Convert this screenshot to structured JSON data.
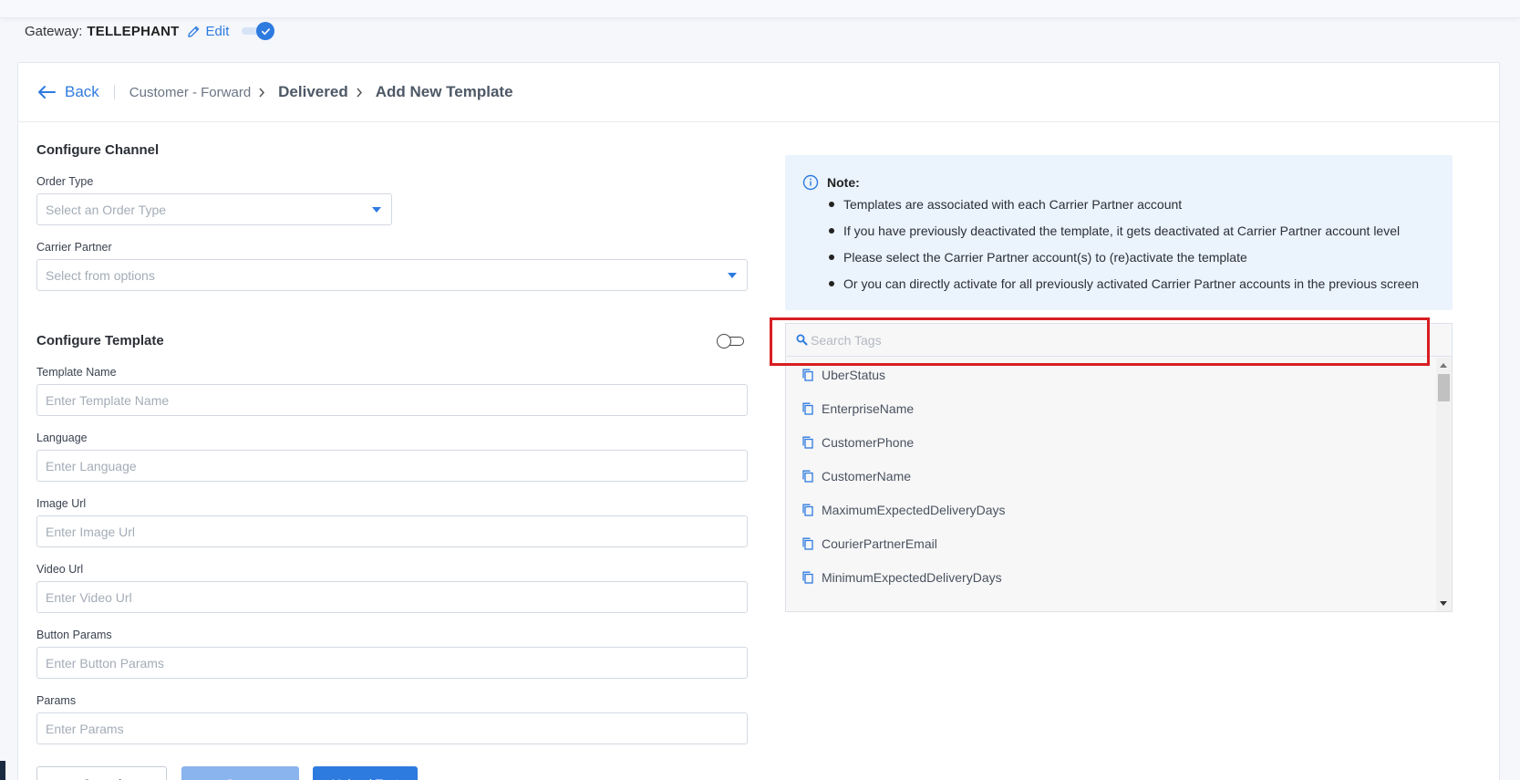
{
  "gateway": {
    "label": "Gateway:",
    "name": "TELLEPHANT",
    "edit_label": "Edit",
    "enabled": true
  },
  "breadcrumb": {
    "back_label": "Back",
    "items": [
      "Customer - Forward",
      "Delivered",
      "Add New Template"
    ]
  },
  "configure_channel": {
    "title": "Configure Channel",
    "order_type": {
      "label": "Order Type",
      "placeholder": "Select an Order Type"
    },
    "carrier_partner": {
      "label": "Carrier Partner",
      "placeholder": "Select from options"
    }
  },
  "configure_template": {
    "title": "Configure Template",
    "toggle_on": false,
    "fields": [
      {
        "label": "Template Name",
        "placeholder": "Enter Template Name"
      },
      {
        "label": "Language",
        "placeholder": "Enter Language"
      },
      {
        "label": "Image Url",
        "placeholder": "Enter Image Url"
      },
      {
        "label": "Video Url",
        "placeholder": "Enter Video Url"
      },
      {
        "label": "Button Params",
        "placeholder": "Enter Button Params"
      },
      {
        "label": "Params",
        "placeholder": "Enter Params"
      }
    ]
  },
  "note": {
    "title": "Note:",
    "items": [
      "Templates are associated with each Carrier Partner account",
      "If you have previously deactivated the template, it gets deactivated at Carrier Partner account level",
      "Please select the Carrier Partner account(s) to (re)activate the template",
      "Or you can directly activate for all previously activated Carrier Partner accounts in the previous screen"
    ]
  },
  "tags": {
    "search_placeholder": "Search Tags",
    "items": [
      "UberStatus",
      "EnterpriseName",
      "CustomerPhone",
      "CustomerName",
      "MaximumExpectedDeliveryDays",
      "CourierPartnerEmail",
      "MinimumExpectedDeliveryDays"
    ]
  },
  "actions": {
    "cancel_label": "Cancel",
    "save_label": "Save",
    "upload_label": "Upload Test"
  },
  "colors": {
    "accent": "#2e7be0",
    "note_bg": "#ebf3fd",
    "highlight": "#d81e22"
  },
  "icons": {
    "edit": "pencil-icon",
    "back": "arrow-left-icon",
    "crumb_sep": "chevron-right-icon",
    "note": "info-icon",
    "search": "search-icon",
    "tag": "copy-icon"
  }
}
